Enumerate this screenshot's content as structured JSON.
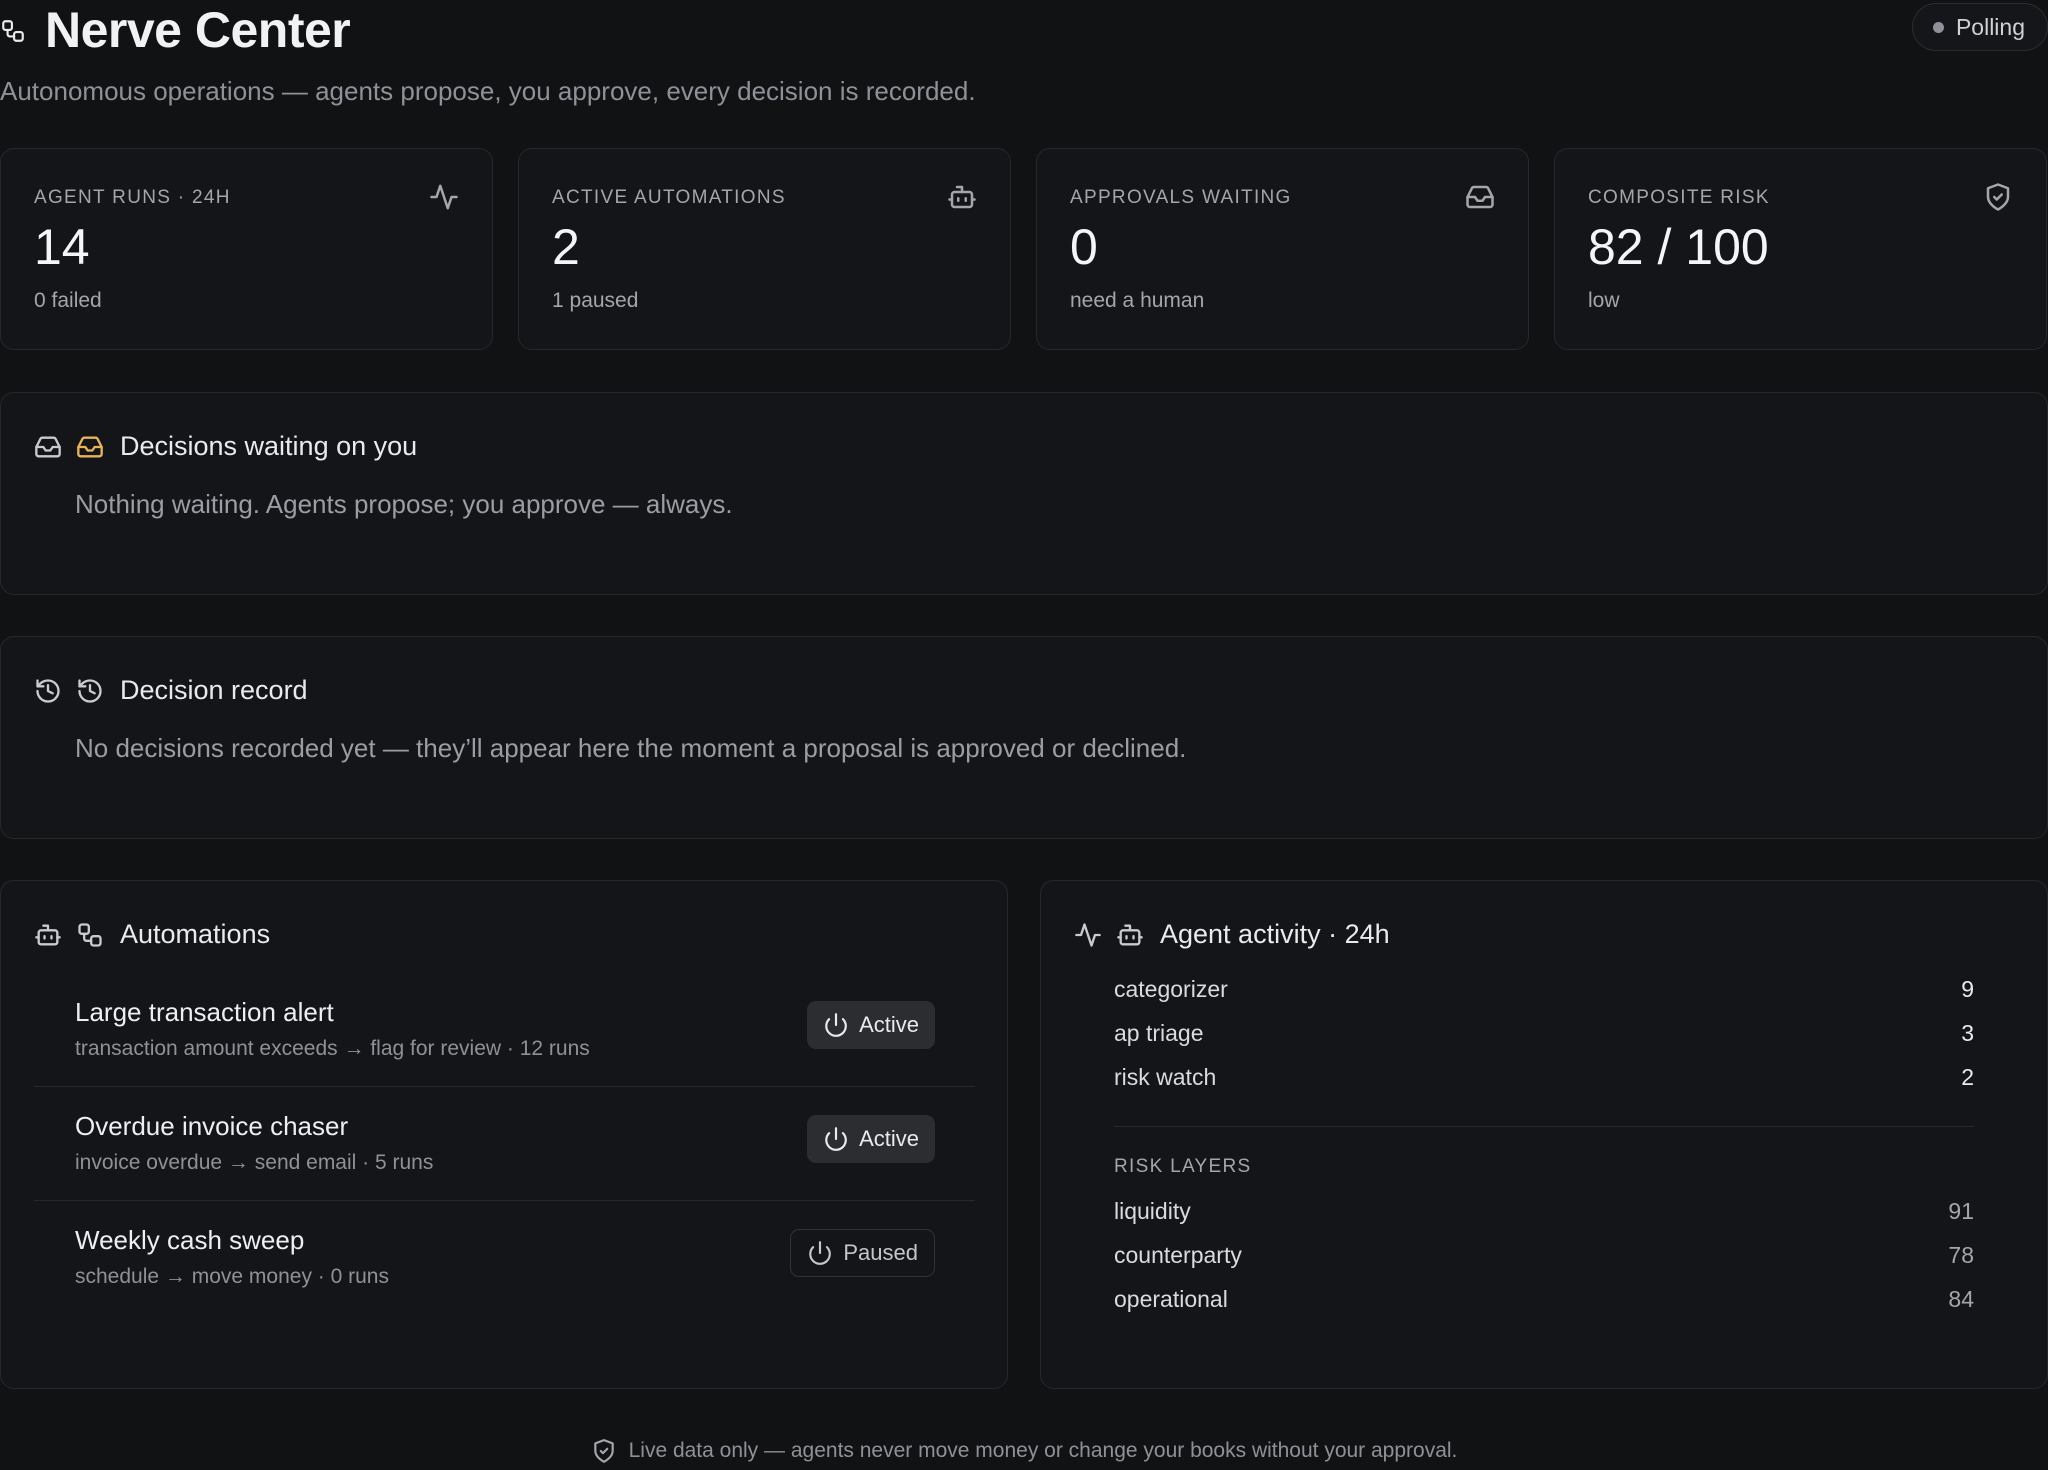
{
  "header": {
    "title": "Nerve Center",
    "subtitle": "Autonomous operations — agents propose, you approve, every decision is recorded.",
    "status": "Polling"
  },
  "stats": [
    {
      "label": "AGENT RUNS · 24H",
      "value": "14",
      "sub": "0 failed",
      "icon": "activity-icon"
    },
    {
      "label": "ACTIVE AUTOMATIONS",
      "value": "2",
      "sub": "1 paused",
      "icon": "bot-icon"
    },
    {
      "label": "APPROVALS WAITING",
      "value": "0",
      "sub": "need a human",
      "icon": "inbox-icon"
    },
    {
      "label": "COMPOSITE RISK",
      "value": "82 / 100",
      "sub": "low",
      "icon": "shield-check-icon"
    }
  ],
  "approvals": {
    "title": "Decisions waiting on you",
    "empty": "Nothing waiting. Agents propose; you approve — always.",
    "accent": "#e8b457"
  },
  "record": {
    "title": "Decision record",
    "empty": "No decisions recorded yet — they’ll appear here the moment a proposal is approved or declined."
  },
  "automations": {
    "title": "Automations",
    "items": [
      {
        "name": "Large transaction alert",
        "meta": "transaction amount exceeds → flag for review · 12 runs",
        "status": "Active"
      },
      {
        "name": "Overdue invoice chaser",
        "meta": "invoice overdue → send email · 5 runs",
        "status": "Active"
      },
      {
        "name": "Weekly cash sweep",
        "meta": "schedule → move money · 0 runs",
        "status": "Paused"
      }
    ]
  },
  "activity": {
    "title": "Agent activity · 24h",
    "agents": [
      {
        "name": "categorizer",
        "count": "9"
      },
      {
        "name": "ap triage",
        "count": "3"
      },
      {
        "name": "risk watch",
        "count": "2"
      }
    ],
    "risk_label": "RISK LAYERS",
    "risk_layers": [
      {
        "name": "liquidity",
        "score": "91"
      },
      {
        "name": "counterparty",
        "score": "78"
      },
      {
        "name": "operational",
        "score": "84"
      }
    ]
  },
  "footer": {
    "text": "Live data only — agents never move money or change your books without your approval."
  }
}
